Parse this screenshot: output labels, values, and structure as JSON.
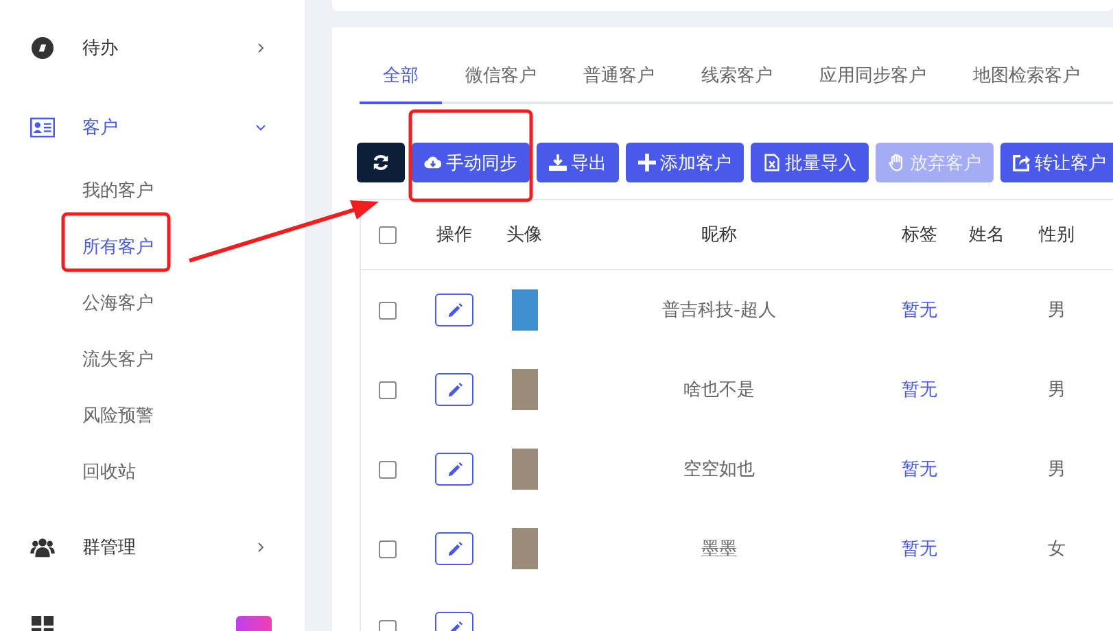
{
  "sidebar": {
    "items": [
      {
        "label": "待办",
        "kind": "todo",
        "expanded": false
      },
      {
        "label": "客户",
        "kind": "customer",
        "expanded": true,
        "children": [
          {
            "label": "我的客户",
            "selected": false
          },
          {
            "label": "所有客户",
            "selected": true
          },
          {
            "label": "公海客户",
            "selected": false
          },
          {
            "label": "流失客户",
            "selected": false
          },
          {
            "label": "风险预警",
            "selected": false
          },
          {
            "label": "回收站",
            "selected": false
          }
        ]
      },
      {
        "label": "群管理",
        "kind": "group",
        "expanded": false
      },
      {
        "kind": "grid",
        "badge": true
      }
    ]
  },
  "tabs": [
    {
      "label": "全部",
      "selected": true
    },
    {
      "label": "微信客户",
      "selected": false
    },
    {
      "label": "普通客户",
      "selected": false
    },
    {
      "label": "线索客户",
      "selected": false
    },
    {
      "label": "应用同步客户",
      "selected": false
    },
    {
      "label": "地图检索客户",
      "selected": false
    }
  ],
  "toolbar": [
    {
      "kind": "refresh",
      "disabled": false
    },
    {
      "kind": "cloud",
      "label": "手动同步",
      "disabled": false
    },
    {
      "kind": "download",
      "label": "导出",
      "disabled": false
    },
    {
      "kind": "plus",
      "label": "添加客户",
      "disabled": false
    },
    {
      "kind": "file",
      "label": "批量导入",
      "disabled": false
    },
    {
      "kind": "hand",
      "label": "放弃客户",
      "disabled": true
    },
    {
      "kind": "share",
      "label": "转让客户",
      "disabled": false
    }
  ],
  "table": {
    "select_all_checked": false,
    "columns": [
      "操作",
      "头像",
      "昵称",
      "标签",
      "姓名",
      "性别"
    ],
    "rows": [
      {
        "kind": "logo",
        "checked": false,
        "nickname": "普吉科技-超人",
        "tag": "暂无",
        "gender": "男"
      },
      {
        "kind": "photo",
        "checked": false,
        "nickname": "啥也不是",
        "tag": "暂无",
        "gender": "男"
      },
      {
        "kind": "photo",
        "checked": false,
        "nickname": "空空如也",
        "tag": "暂无",
        "gender": "男"
      },
      {
        "kind": "photo",
        "checked": false,
        "nickname": "墨墨",
        "tag": "暂无",
        "gender": "女"
      },
      {
        "kind": "cut",
        "checked": false
      }
    ]
  }
}
